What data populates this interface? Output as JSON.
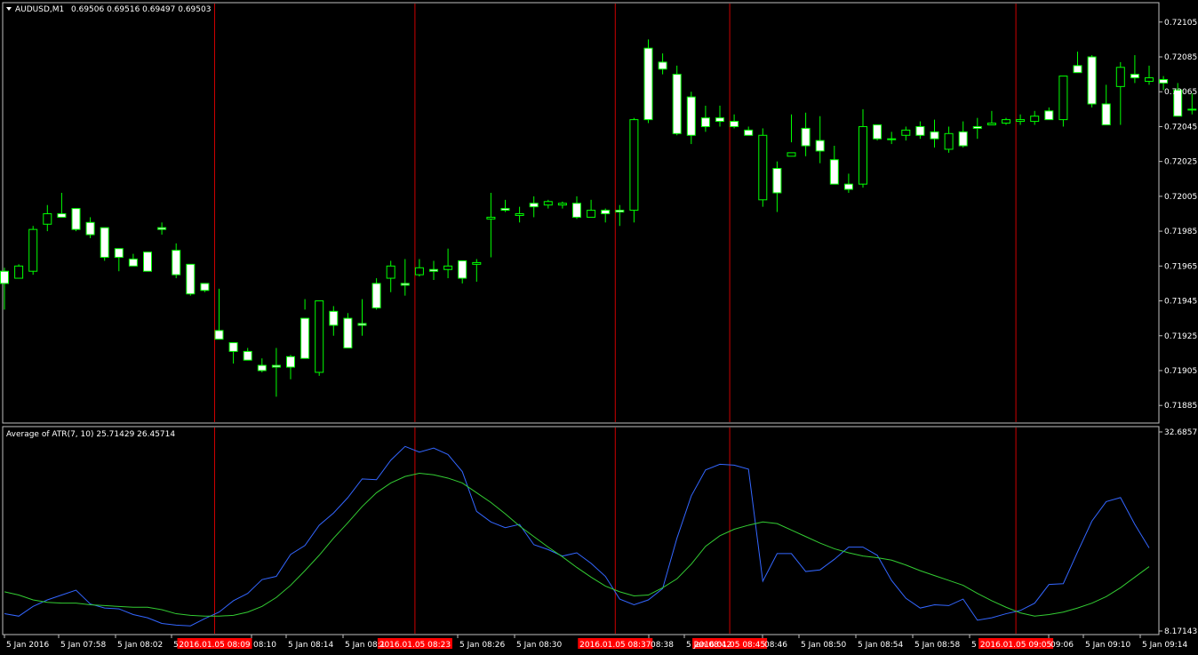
{
  "symbol_label": "AUDUSD,M1",
  "ohlc_values": "0.69506 0.69516 0.69497 0.69503",
  "indicator_label": "Average of ATR(7, 10) 25.71429 26.45714",
  "colors": {
    "background": "#000000",
    "frame": "#c0c0c0",
    "bull_candle": "#00ff00",
    "bear_candle_fill": "#ffffff",
    "bear_candle_border": "#00ff00",
    "atr_fast": "#3366ff",
    "atr_slow": "#33cc33",
    "marker_line": "#cc0000",
    "marker_label_bg": "#ff0000"
  },
  "chart_data": [
    {
      "type": "candlestick",
      "price_range": [
        0.7188,
        0.7211
      ],
      "y_ticks": [
        "0.72105",
        "0.72085",
        "0.72065",
        "0.72045",
        "0.72025",
        "0.72005",
        "0.71985",
        "0.71965",
        "0.71945",
        "0.71925",
        "0.71905",
        "0.71885"
      ],
      "candles": [
        [
          0.71962,
          0.71964,
          0.7194,
          0.71955
        ],
        [
          0.71958,
          0.71966,
          0.71958,
          0.71965
        ],
        [
          0.71962,
          0.71988,
          0.7196,
          0.71986
        ],
        [
          0.71989,
          0.72,
          0.71985,
          0.71995
        ],
        [
          0.71995,
          0.72007,
          0.71993,
          0.71993
        ],
        [
          0.71998,
          0.71996,
          0.71985,
          0.71986
        ],
        [
          0.7199,
          0.71993,
          0.71981,
          0.71983
        ],
        [
          0.71987,
          0.71984,
          0.71968,
          0.7197
        ],
        [
          0.71975,
          0.71975,
          0.71962,
          0.7197
        ],
        [
          0.71969,
          0.71972,
          0.71965,
          0.71965
        ],
        [
          0.71973,
          0.71973,
          0.71965,
          0.71962
        ],
        [
          0.71987,
          0.7199,
          0.71983,
          0.71986
        ],
        [
          0.71974,
          0.71978,
          0.71958,
          0.7196
        ],
        [
          0.71966,
          0.71963,
          0.71948,
          0.71949
        ],
        [
          0.71955,
          0.71955,
          0.7195,
          0.71951
        ],
        [
          0.71928,
          0.71952,
          0.71923,
          0.71923
        ],
        [
          0.71921,
          0.71921,
          0.71909,
          0.71916
        ],
        [
          0.71916,
          0.71918,
          0.71913,
          0.71911
        ],
        [
          0.71908,
          0.71912,
          0.71904,
          0.71905
        ],
        [
          0.71908,
          0.71918,
          0.7189,
          0.71907
        ],
        [
          0.71913,
          0.71914,
          0.719,
          0.71907
        ],
        [
          0.71935,
          0.71946,
          0.7194,
          0.71912
        ],
        [
          0.71904,
          0.71902,
          0.71925,
          0.71945
        ],
        [
          0.71939,
          0.71942,
          0.71925,
          0.71931
        ],
        [
          0.71935,
          0.71938,
          0.7192,
          0.71918
        ],
        [
          0.71932,
          0.71946,
          0.71925,
          0.71931
        ],
        [
          0.71955,
          0.71958,
          0.7194,
          0.71941
        ],
        [
          0.71958,
          0.71968,
          0.7195,
          0.71965
        ],
        [
          0.71955,
          0.71969,
          0.71948,
          0.71954
        ],
        [
          0.7196,
          0.71969,
          0.71959,
          0.71964
        ],
        [
          0.71963,
          0.71968,
          0.71957,
          0.71962
        ],
        [
          0.71963,
          0.71975,
          0.71958,
          0.71965
        ],
        [
          0.71968,
          0.71968,
          0.71955,
          0.71958
        ],
        [
          0.71966,
          0.71969,
          0.71956,
          0.71967
        ],
        [
          0.71992,
          0.72007,
          0.7197,
          0.71993
        ],
        [
          0.71998,
          0.72003,
          0.71996,
          0.71997
        ],
        [
          0.71994,
          0.71999,
          0.7199,
          0.71995
        ],
        [
          0.72001,
          0.72005,
          0.71993,
          0.71999
        ],
        [
          0.72,
          0.72003,
          0.71998,
          0.72002
        ],
        [
          0.72,
          0.72002,
          0.71998,
          0.72001
        ],
        [
          0.72001,
          0.72005,
          0.71992,
          0.71993
        ],
        [
          0.71993,
          0.72003,
          0.71994,
          0.71997
        ],
        [
          0.71997,
          0.71998,
          0.7199,
          0.71995
        ],
        [
          0.71997,
          0.72,
          0.71988,
          0.71996
        ],
        [
          0.71997,
          0.7205,
          0.7199,
          0.72049
        ],
        [
          0.7209,
          0.72095,
          0.72047,
          0.72049
        ],
        [
          0.72082,
          0.72087,
          0.72075,
          0.72078
        ],
        [
          0.72075,
          0.7208,
          0.7204,
          0.72041
        ],
        [
          0.72062,
          0.72065,
          0.72035,
          0.7204
        ],
        [
          0.7205,
          0.72057,
          0.72042,
          0.72045
        ],
        [
          0.7205,
          0.72057,
          0.72045,
          0.72048
        ],
        [
          0.72048,
          0.72052,
          0.72044,
          0.72045
        ],
        [
          0.72043,
          0.72045,
          0.7204,
          0.7204
        ],
        [
          0.72003,
          0.72044,
          0.71999,
          0.7204
        ],
        [
          0.72021,
          0.72025,
          0.71996,
          0.72007
        ],
        [
          0.72028,
          0.72052,
          0.72036,
          0.7203
        ],
        [
          0.72044,
          0.72053,
          0.72028,
          0.72034
        ],
        [
          0.72037,
          0.72051,
          0.72024,
          0.72031
        ],
        [
          0.72026,
          0.72034,
          0.72013,
          0.72012
        ],
        [
          0.72012,
          0.72018,
          0.72007,
          0.72009
        ],
        [
          0.72012,
          0.72055,
          0.7201,
          0.72045
        ],
        [
          0.72046,
          0.72043,
          0.72037,
          0.72038
        ],
        [
          0.72038,
          0.72042,
          0.72035,
          0.72038
        ],
        [
          0.7204,
          0.72045,
          0.72037,
          0.72043
        ],
        [
          0.72045,
          0.72048,
          0.72038,
          0.7204
        ],
        [
          0.72042,
          0.72049,
          0.72033,
          0.72038
        ],
        [
          0.72032,
          0.72045,
          0.7203,
          0.72041
        ],
        [
          0.72042,
          0.72048,
          0.72033,
          0.72034
        ],
        [
          0.72045,
          0.7205,
          0.72038,
          0.72044
        ],
        [
          0.72046,
          0.72054,
          0.72046,
          0.72047
        ],
        [
          0.72047,
          0.7205,
          0.72046,
          0.72049
        ],
        [
          0.72048,
          0.72052,
          0.72046,
          0.72049
        ],
        [
          0.72048,
          0.72054,
          0.72046,
          0.72051
        ],
        [
          0.72054,
          0.72056,
          0.72049,
          0.72049
        ],
        [
          0.72049,
          0.72074,
          0.72045,
          0.72074
        ],
        [
          0.7208,
          0.72088,
          0.72076,
          0.72076
        ],
        [
          0.72085,
          0.72086,
          0.72056,
          0.72058
        ],
        [
          0.72058,
          0.72069,
          0.72046,
          0.72046
        ],
        [
          0.72068,
          0.72082,
          0.72046,
          0.72079
        ],
        [
          0.72075,
          0.72086,
          0.7207,
          0.72073
        ],
        [
          0.72071,
          0.7208,
          0.72069,
          0.72073
        ],
        [
          0.72072,
          0.72074,
          0.72066,
          0.7207
        ],
        [
          0.72066,
          0.7207,
          0.72052,
          0.72051
        ],
        [
          0.72055,
          0.72064,
          0.72052,
          0.72055
        ]
      ]
    },
    {
      "type": "line",
      "value_range": [
        8.17143,
        32.68571
      ],
      "y_ticks": [
        "32.68571",
        "8.17143"
      ],
      "x_labels": [
        "5 Jan 2016",
        "5 Jan 07:58",
        "5 Jan 08:02",
        "5",
        "08:10",
        "5 Jan 08:14",
        "5 Jan 08:1",
        "5 Jan 08:26",
        "5 Jan 08:30",
        "08:38",
        "5 Jan 08:42",
        "08:46",
        "5 Jan 08:50",
        "5 Jan 08:54",
        "5 Jan 08:58",
        "5",
        "09:06",
        "5 Jan 09:10",
        "5 Jan 09:14"
      ],
      "markers": [
        {
          "label": "2016.01.05 08:09",
          "bar": 15
        },
        {
          "label": "2016.01.05 08:23",
          "bar": 29
        },
        {
          "label": "2016.01.05 08:37",
          "bar": 43
        },
        {
          "label": "2016.01.05 08:45",
          "bar": 51
        },
        {
          "label": "2016.01.05 09:05",
          "bar": 71
        }
      ],
      "series": [
        {
          "values": [
            10.3,
            10.0,
            11.2,
            12.0,
            12.6,
            13.2,
            11.5,
            11.0,
            10.9,
            10.2,
            9.8,
            9.1,
            8.9,
            8.8,
            9.7,
            10.5,
            11.9,
            12.8,
            14.5,
            14.9,
            17.6,
            18.7,
            21.2,
            22.7,
            24.6,
            26.9,
            26.8,
            29.2,
            30.9,
            30.2,
            30.7,
            29.9,
            27.8,
            22.9,
            21.6,
            20.9,
            21.3,
            18.8,
            18.2,
            17.4,
            17.8,
            16.5,
            14.9,
            12.1,
            11.4,
            12.0,
            13.4,
            19.6,
            24.8,
            28.0,
            28.7,
            28.6,
            28.1,
            14.3,
            17.7,
            17.7,
            15.5,
            15.7,
            17.0,
            18.5,
            18.5,
            17.5,
            14.4,
            12.2,
            11.0,
            11.4,
            11.3,
            12.1,
            9.5,
            9.8,
            10.3,
            10.7,
            11.6,
            13.9,
            14.0,
            17.9,
            21.7,
            24.1,
            24.6,
            21.3,
            18.4
          ]
        },
        {
          "values": [
            13.0,
            12.6,
            12.0,
            11.7,
            11.6,
            11.6,
            11.4,
            11.3,
            11.2,
            11.1,
            11.1,
            10.8,
            10.3,
            10.1,
            10.0,
            10.0,
            10.1,
            10.5,
            11.2,
            12.3,
            13.8,
            15.6,
            17.5,
            19.6,
            21.5,
            23.5,
            25.2,
            26.4,
            27.2,
            27.6,
            27.4,
            27.0,
            26.4,
            25.2,
            24.0,
            22.6,
            21.1,
            19.8,
            18.5,
            17.3,
            16.0,
            14.8,
            13.7,
            13.0,
            12.5,
            12.6,
            13.5,
            14.6,
            16.4,
            18.6,
            19.9,
            20.7,
            21.2,
            21.6,
            21.4,
            20.6,
            19.8,
            19.0,
            18.3,
            17.8,
            17.4,
            17.2,
            16.9,
            16.3,
            15.6,
            15.0,
            14.4,
            13.8,
            12.8,
            11.9,
            11.1,
            10.4,
            10.0,
            10.2,
            10.5,
            11.0,
            11.6,
            12.4,
            13.5,
            14.8,
            16.1
          ]
        }
      ]
    }
  ]
}
